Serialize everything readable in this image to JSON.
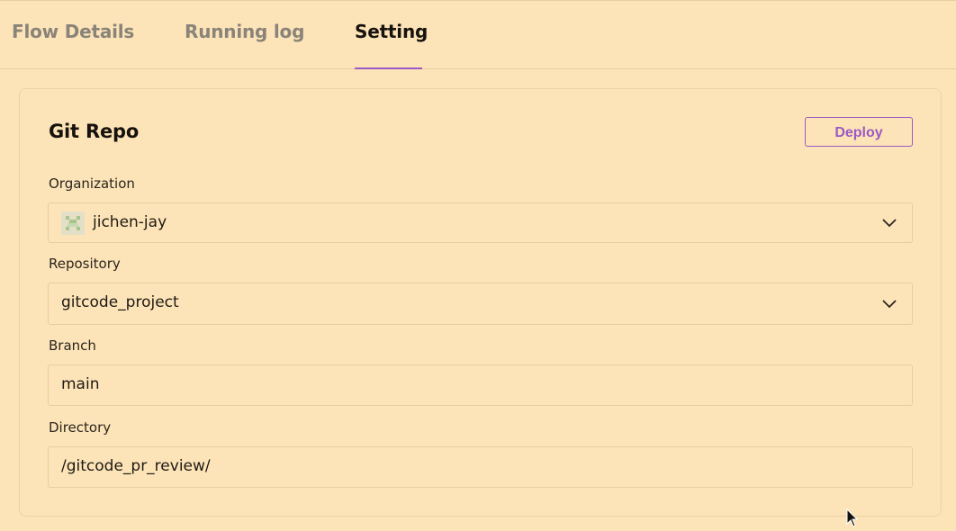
{
  "tabs": [
    {
      "label": "Flow Details",
      "active": false
    },
    {
      "label": "Running log",
      "active": false
    },
    {
      "label": "Setting",
      "active": true
    }
  ],
  "card": {
    "title": "Git Repo",
    "deploy_label": "Deploy"
  },
  "fields": {
    "organization": {
      "label": "Organization",
      "value": "jichen-jay"
    },
    "repository": {
      "label": "Repository",
      "value": "gitcode_project"
    },
    "branch": {
      "label": "Branch",
      "value": "main"
    },
    "directory": {
      "label": "Directory",
      "value": "/gitcode_pr_review/"
    }
  },
  "colors": {
    "background": "#fde4b8",
    "accent": "#9b59c4",
    "border": "#e6cda2"
  },
  "icons": {
    "avatar": "pixel-avatar-icon",
    "dropdown": "chevron-down-icon",
    "cursor": "mouse-cursor-icon"
  }
}
